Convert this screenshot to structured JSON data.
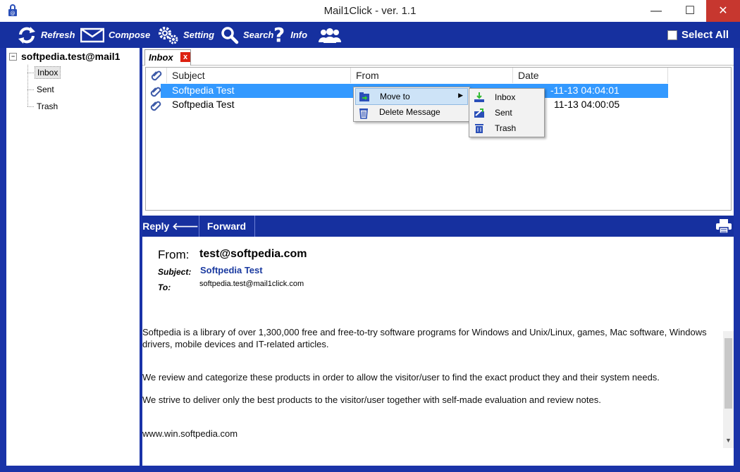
{
  "window": {
    "title": "Mail1Click - ver. 1.1",
    "minimize": "—",
    "maximize": "☐",
    "close": "✕"
  },
  "toolbar": {
    "refresh": "Refresh",
    "compose": "Compose",
    "setting": "Setting",
    "search": "Search",
    "info": "Info",
    "select_all": "Select All"
  },
  "tree": {
    "account": "softpedia.test@mail1",
    "folders": [
      "Inbox",
      "Sent",
      "Trash"
    ]
  },
  "tabs": [
    {
      "label": "Inbox",
      "close": "x"
    }
  ],
  "list": {
    "columns": [
      "Subject",
      "From",
      "Date"
    ],
    "rows": [
      {
        "subject": "Softpedia Test",
        "from": "",
        "date": "2013-11-13 04:04:01",
        "date_visible": "-11-13 04:04:01"
      },
      {
        "subject": "Softpedia Test",
        "from": "",
        "date": "2013-11-13 04:00:05",
        "date_visible": "11-13 04:00:05"
      }
    ]
  },
  "context_menu": {
    "items": [
      "Move to",
      "Delete Message"
    ],
    "submenu": [
      "Inbox",
      "Sent",
      "Trash"
    ]
  },
  "reply_bar": {
    "reply": "Reply",
    "forward": "Forward"
  },
  "message": {
    "from_label": "From:",
    "from": "test@softpedia.com",
    "subject_label": "Subject:",
    "subject": "Softpedia Test",
    "to_label": "To:",
    "to": "softpedia.test@mail1click.com",
    "paragraphs": [
      "Softpedia is a library of over 1,300,000 free and free-to-try software programs for Windows and Unix/Linux, games, Mac software, Windows drivers, mobile devices and IT-related articles.",
      "We review and categorize these products in order to allow the visitor/user to find the exact product they and their system needs.",
      "We strive to deliver only the best products to the visitor/user together with self-made evaluation and review notes.",
      "www.win.softpedia.com"
    ]
  },
  "colors": {
    "accent": "#16309f",
    "selection": "#3399ff",
    "close": "#c7372f"
  }
}
